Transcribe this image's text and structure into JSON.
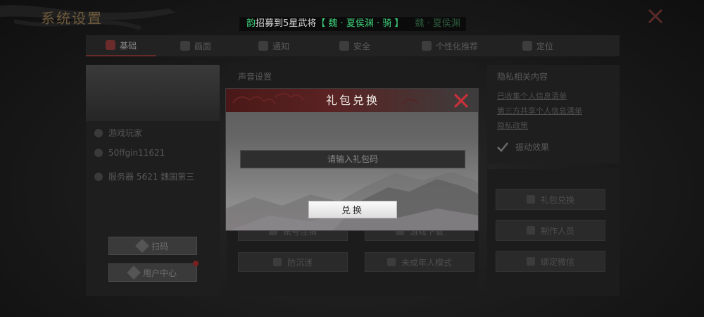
{
  "system": {
    "title": "系统设置"
  },
  "ticker": {
    "prefix": "韵",
    "message": "招募到5星武将",
    "highlight": "【 魏 · 夏侯渊 · 骑 】",
    "trail": "魏 · 夏侯渊"
  },
  "tabs": [
    {
      "label": "基础",
      "icon": "home-icon",
      "active": true
    },
    {
      "label": "画面",
      "icon": "image-icon",
      "active": false
    },
    {
      "label": "通知",
      "icon": "chat-icon",
      "active": false
    },
    {
      "label": "安全",
      "icon": "shield-icon",
      "active": false
    },
    {
      "label": "个性化推荐",
      "icon": "thumb-icon",
      "active": false
    },
    {
      "label": "定位",
      "icon": "location-icon",
      "active": false
    }
  ],
  "profile": {
    "name": "游戏玩家",
    "id": "50ffgin11621",
    "server": "服务器 5621 魏国第三",
    "scan_button": "扫码",
    "user_center_button": "用户中心"
  },
  "sound": {
    "title": "声音设置",
    "buttons": [
      "账号注销",
      "游戏下载",
      "防沉迷",
      "未成年人模式"
    ]
  },
  "privacy": {
    "title": "隐私相关内容",
    "links": [
      "已收集个人信息清单",
      "第三方共享个人信息清单",
      "隐私政策"
    ],
    "check_label": "振动效果"
  },
  "right_buttons": [
    "礼包兑换",
    "制作人员",
    "绑定微信"
  ],
  "dialog": {
    "title": "礼包兑换",
    "placeholder": "请输入礼包码",
    "value": "",
    "redeem_button": "兑换"
  },
  "colors": {
    "dialog_header": "#4a1818",
    "close_red": "#c8303a",
    "ticker_green": "#3fcf7a"
  }
}
